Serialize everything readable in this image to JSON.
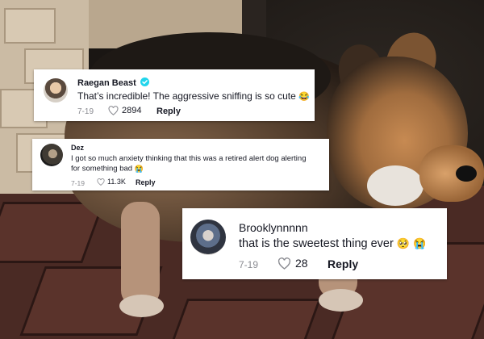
{
  "comments": [
    {
      "username": "Raegan Beast",
      "verified": true,
      "text": "That’s incredible! The aggressive sniffing is so cute",
      "emoji": "😂",
      "date": "7-19",
      "likes": "2894",
      "reply_label": "Reply"
    },
    {
      "username": "Dez",
      "verified": false,
      "text_line1": "I got so much anxiety thinking that this was a retired alert dog alerting",
      "text_line2": "for something bad",
      "emoji": "😭",
      "date": "7-19",
      "likes": "11.3K",
      "reply_label": "Reply"
    },
    {
      "username": "Brooklynnnnn",
      "verified": false,
      "text": "that is the sweetest thing ever",
      "emojis": [
        "🥺",
        "😭"
      ],
      "date": "7-19",
      "likes": "28",
      "reply_label": "Reply"
    }
  ],
  "colors": {
    "card_bg": "#ffffff",
    "text": "#161823",
    "meta": "#8a8b91",
    "verified": "#20d5ec"
  },
  "icons": [
    "heart-outline-icon",
    "verified-badge-icon"
  ]
}
